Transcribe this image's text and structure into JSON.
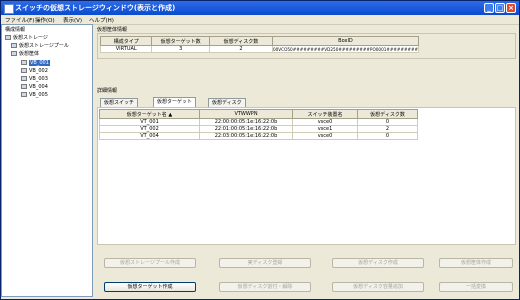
{
  "window": {
    "title": "スイッチの仮想ストレージウィンドウ(表示と作成)"
  },
  "menu": [
    "ファイル(F)",
    "操作(O)",
    "表示(V)",
    "ヘルプ(H)"
  ],
  "tree": {
    "label": "構成情報",
    "root": "仮想ストレージ",
    "pool": "仮想ストレージプール",
    "enclosure": "仮想筐体",
    "items": [
      "VB_001",
      "VB_002",
      "VB_003",
      "VB_004",
      "VB_005"
    ]
  },
  "enclosure_info": {
    "label": "仮想筐体情報",
    "headers": [
      "構成タイプ",
      "仮想ターゲット数",
      "仮想ディスク数",
      "BoxID"
    ],
    "row": [
      "VIRTUAL",
      "3",
      "2",
      "00VCO50#########VD250#########PO0001#########"
    ]
  },
  "detail": {
    "label": "詳細情報",
    "tabs": [
      "仮想スイッチ",
      "仮想ターゲット",
      "仮想ディスク"
    ],
    "headers": [
      "仮想ターゲット名",
      "VTWWPN",
      "スイッチ装置名",
      "仮想ディスク数"
    ],
    "rows": [
      [
        "VT_001",
        "22:00:00:05:1e:16:22:0b",
        "vsce0",
        "0"
      ],
      [
        "VT_002",
        "22:01:00:05:1e:16:22:0b",
        "vsce1",
        "2"
      ],
      [
        "VT_004",
        "22:03:00:05:1e:16:22:0b",
        "vsce0",
        "0"
      ]
    ]
  },
  "buttons": {
    "row1": [
      "仮想ストレージプール作成",
      "実ディスク登録",
      "仮想ディスク作成",
      "仮想筐体作成"
    ],
    "row2": [
      "仮想ターゲット作成",
      "仮想ディスク割付・解除",
      "仮想ディスク容量追加",
      "一括変換"
    ]
  }
}
